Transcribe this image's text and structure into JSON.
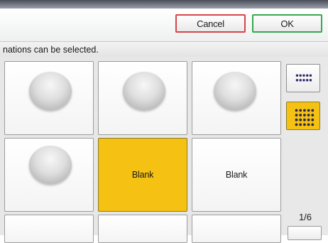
{
  "header": {
    "cancel_label": "Cancel",
    "ok_label": "OK"
  },
  "message": "nations can be selected.",
  "cells": [
    {
      "label": "",
      "type": "stamp"
    },
    {
      "label": "",
      "type": "stamp"
    },
    {
      "label": "",
      "type": "stamp"
    },
    {
      "label": "",
      "type": "stamp"
    },
    {
      "label": "Blank",
      "type": "text",
      "selected": true
    },
    {
      "label": "Blank",
      "type": "text",
      "selected": false
    }
  ],
  "side": {
    "view_small_icon": "grid-small-icon",
    "view_large_icon": "grid-large-icon",
    "page_indicator": "1/6"
  },
  "colors": {
    "selected": "#f5c113",
    "cancel_border": "#d64548",
    "ok_border": "#35a84e"
  }
}
